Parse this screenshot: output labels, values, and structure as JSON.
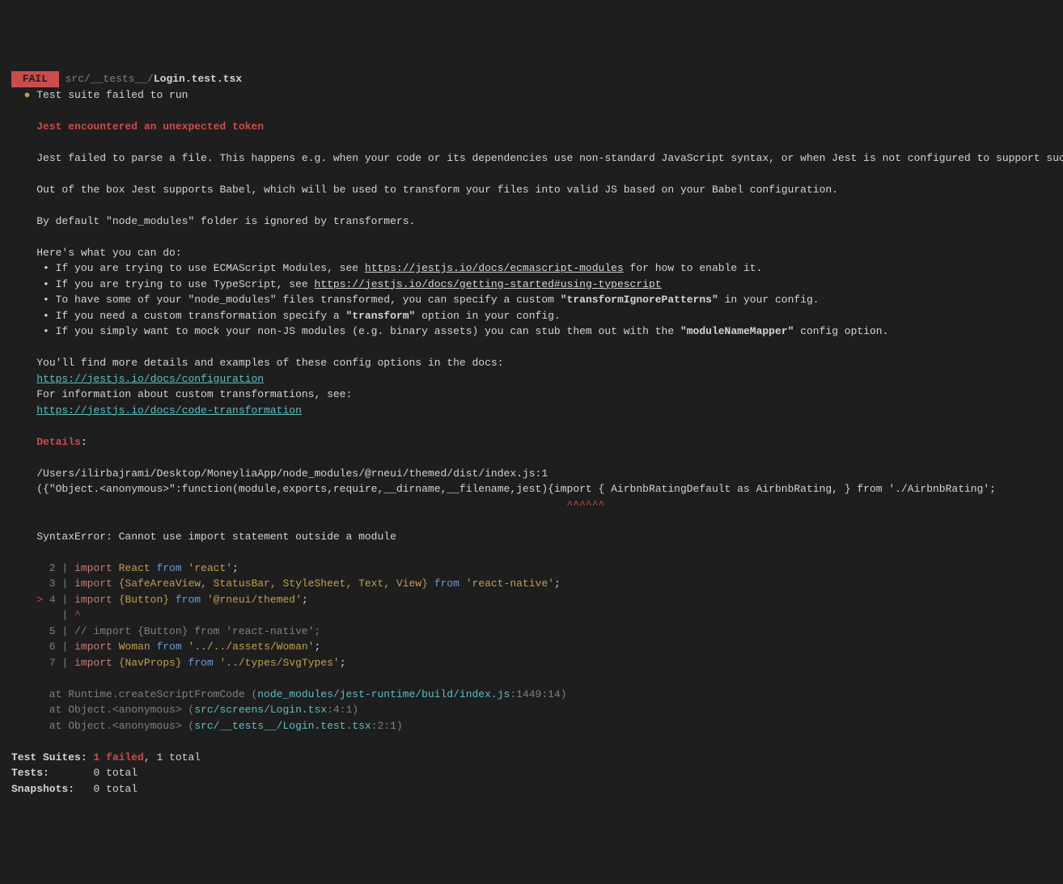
{
  "header": {
    "badge": " FAIL ",
    "path_dim": "src/__tests__/",
    "path_file": "Login.test.tsx",
    "bullet": "●",
    "suite_failed": "Test suite failed to run"
  },
  "heading1": "Jest encountered an unexpected token",
  "para1": "Jest failed to parse a file. This happens e.g. when your code or its dependencies use non-standard JavaScript syntax, or when Jest is not configured to support such syntax.",
  "para2": "Out of the box Jest supports Babel, which will be used to transform your files into valid JS based on your Babel configuration.",
  "para3": "By default \"node_modules\" folder is ignored by transformers.",
  "hint_intro": "Here's what you can do:",
  "bullets": {
    "b1a": " • If you are trying to use ECMAScript Modules, see ",
    "b1_link": "https://jestjs.io/docs/ecmascript-modules",
    "b1b": " for how to enable it.",
    "b2a": " • If you are trying to use TypeScript, see ",
    "b2_link": "https://jestjs.io/docs/getting-started#using-typescript",
    "b3a": " • To have some of your \"node_modules\" files transformed, you can specify a custom ",
    "b3_bold": "\"transformIgnorePatterns\"",
    "b3b": " in your config.",
    "b4a": " • If you need a custom transformation specify a ",
    "b4_bold": "\"transform\"",
    "b4b": " option in your config.",
    "b5a": " • If you simply want to mock your non-JS modules (e.g. binary assets) you can stub them out with the ",
    "b5_bold": "\"moduleNameMapper\"",
    "b5b": " config option."
  },
  "docs": {
    "line1": "You'll find more details and examples of these config options in the docs:",
    "link1": "https://jestjs.io/docs/configuration",
    "line2": "For information about custom transformations, see:",
    "link2": "https://jestjs.io/docs/code-transformation"
  },
  "details_heading": "Details",
  "details_colon": ":",
  "details": {
    "file": "/Users/ilirbajrami/Desktop/MoneyliaApp/node_modules/@rneui/themed/dist/index.js:1",
    "code": "({\"Object.<anonymous>\":function(module,exports,require,__dirname,__filename,jest){import { AirbnbRatingDefault as AirbnbRating, } from './AirbnbRating';",
    "caret": "                                                                                    ^^^^^^",
    "syntax_err": "SyntaxError: Cannot use import statement outside a module"
  },
  "code": {
    "l2_num": "      2 |",
    "l2_import": " import",
    "l2_react": " React",
    "l2_from": " from",
    "l2_str": " 'react'",
    "l2_semi": ";",
    "l3_num": "      3 |",
    "l3_import": " import",
    "l3_ident": " {SafeAreaView, StatusBar, StyleSheet, Text, View}",
    "l3_from": " from",
    "l3_str": " 'react-native'",
    "l3_semi": ";",
    "l4_arrow": "    >",
    "l4_num": " 4 |",
    "l4_import": " import",
    "l4_ident": " {Button}",
    "l4_from": " from",
    "l4_str": " '@rneui/themed'",
    "l4_semi": ";",
    "l4b_num": "        |",
    "l4b_caret": " ^",
    "l5_num": "      5 |",
    "l5_comment": " // import {Button} from 'react-native';",
    "l6_num": "      6 |",
    "l6_import": " import",
    "l6_ident": " Woman",
    "l6_from": " from",
    "l6_str": " '../../assets/Woman'",
    "l6_semi": ";",
    "l7_num": "      7 |",
    "l7_import": " import",
    "l7_ident": " {NavProps}",
    "l7_from": " from",
    "l7_str": " '../types/SvgTypes'",
    "l7_semi": ";"
  },
  "stack": {
    "s1a": "      at Runtime.createScriptFromCode (",
    "s1_file": "node_modules/jest-runtime/build/index.js",
    "s1b": ":1449:14)",
    "s2a": "      at Object.<anonymous> (",
    "s2_file": "src/screens/Login.tsx",
    "s2b": ":4:1)",
    "s3a": "      at Object.<anonymous> (",
    "s3_file": "src/__tests__/Login.test.tsx",
    "s3b": ":2:1)"
  },
  "summary": {
    "suites_label": "Test Suites: ",
    "suites_fail": "1 failed",
    "suites_rest": ", 1 total",
    "tests_label": "Tests:       ",
    "tests_rest": "0 total",
    "snapshots_label": "Snapshots:   ",
    "snapshots_rest": "0 total"
  }
}
